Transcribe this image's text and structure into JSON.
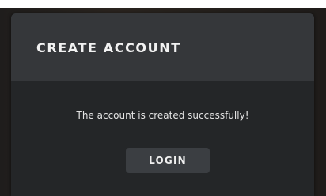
{
  "dialog": {
    "title": "CREATE ACCOUNT",
    "message": "The account is created successfully!",
    "login_label": "LOGIN"
  },
  "colors": {
    "dialog_header": "#35373a",
    "dialog_body": "#242628",
    "button": "#3b3e42",
    "text": "#f2f2f2"
  }
}
